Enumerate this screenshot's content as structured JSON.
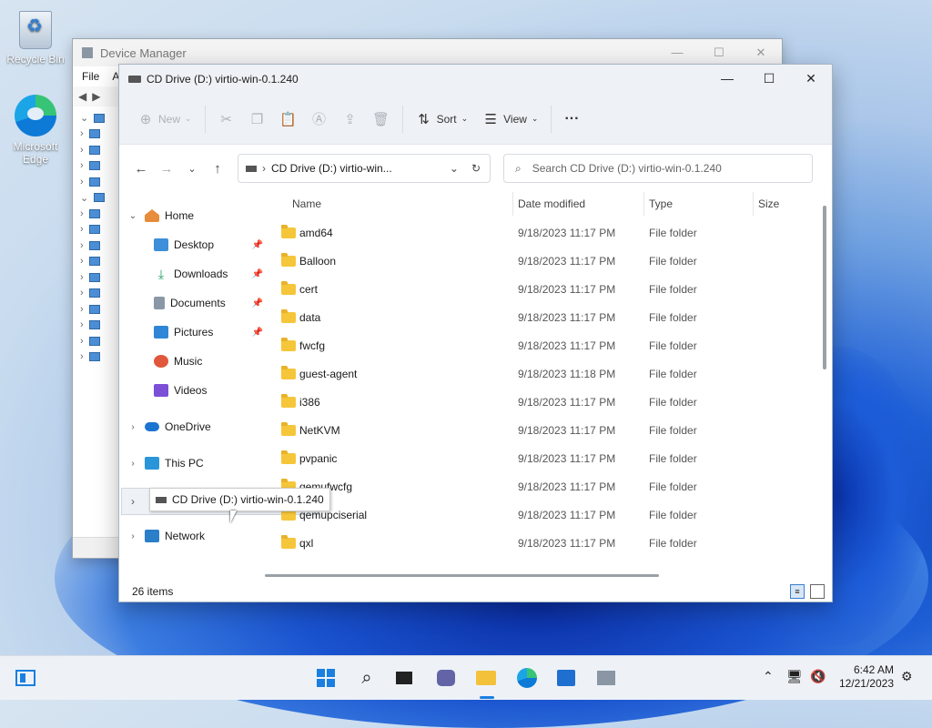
{
  "desktop": {
    "icons": [
      {
        "label": "Recycle Bin"
      },
      {
        "label": "Microsoft Edge"
      }
    ]
  },
  "device_manager": {
    "title": "Device Manager",
    "menu": [
      "File",
      "A"
    ]
  },
  "explorer": {
    "title": "CD Drive (D:) virtio-win-0.1.240",
    "commands": {
      "new": "New",
      "sort": "Sort",
      "view": "View",
      "more": "···"
    },
    "address": "CD Drive (D:) virtio-win...",
    "search_placeholder": "Search CD Drive (D:) virtio-win-0.1.240",
    "nav": {
      "home": "Home",
      "desktop": "Desktop",
      "downloads": "Downloads",
      "documents": "Documents",
      "pictures": "Pictures",
      "music": "Music",
      "videos": "Videos",
      "onedrive": "OneDrive",
      "thispc": "This PC",
      "cddrive": "CD Drive (D:) virtio-win-0.1.240",
      "network": "Network"
    },
    "drag_label": "CD Drive (D:) virtio-win-0.1.240",
    "columns": {
      "name": "Name",
      "date": "Date modified",
      "type": "Type",
      "size": "Size"
    },
    "rows": [
      {
        "name": "amd64",
        "date": "9/18/2023 11:17 PM",
        "type": "File folder"
      },
      {
        "name": "Balloon",
        "date": "9/18/2023 11:17 PM",
        "type": "File folder"
      },
      {
        "name": "cert",
        "date": "9/18/2023 11:17 PM",
        "type": "File folder"
      },
      {
        "name": "data",
        "date": "9/18/2023 11:17 PM",
        "type": "File folder"
      },
      {
        "name": "fwcfg",
        "date": "9/18/2023 11:17 PM",
        "type": "File folder"
      },
      {
        "name": "guest-agent",
        "date": "9/18/2023 11:18 PM",
        "type": "File folder"
      },
      {
        "name": "i386",
        "date": "9/18/2023 11:17 PM",
        "type": "File folder"
      },
      {
        "name": "NetKVM",
        "date": "9/18/2023 11:17 PM",
        "type": "File folder"
      },
      {
        "name": "pvpanic",
        "date": "9/18/2023 11:17 PM",
        "type": "File folder"
      },
      {
        "name": "qemufwcfg",
        "date": "9/18/2023 11:17 PM",
        "type": "File folder"
      },
      {
        "name": "qemupciserial",
        "date": "9/18/2023 11:17 PM",
        "type": "File folder"
      },
      {
        "name": "qxl",
        "date": "9/18/2023 11:17 PM",
        "type": "File folder"
      }
    ],
    "status": "26 items"
  },
  "taskbar": {
    "time": "6:42 AM",
    "date": "12/21/2023"
  }
}
